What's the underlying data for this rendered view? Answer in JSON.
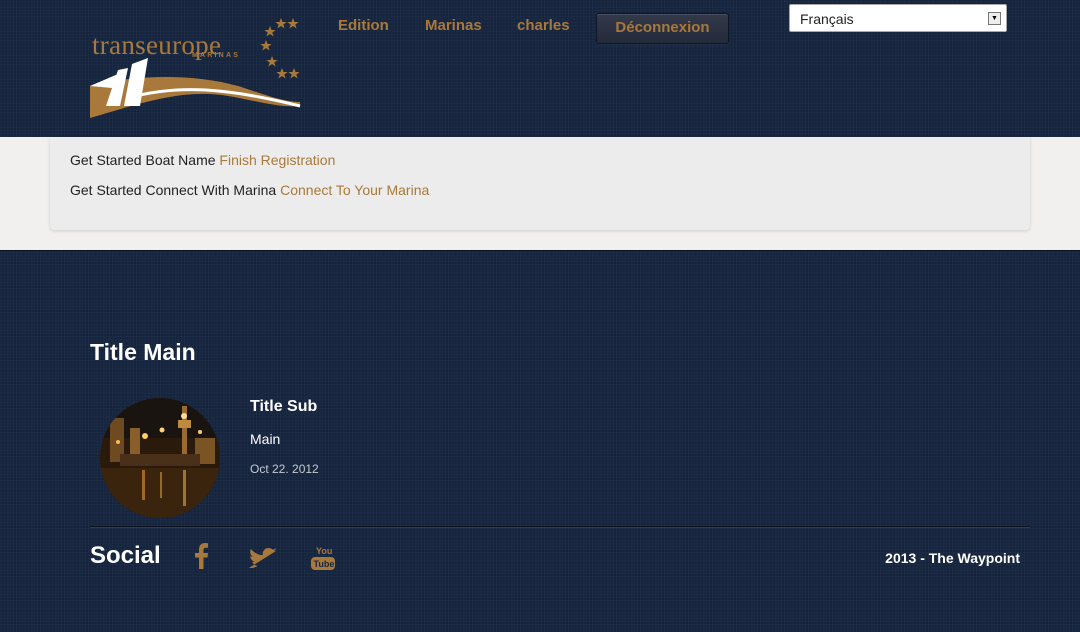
{
  "header": {
    "logo": {
      "name": "transeurope",
      "sub": "MARINAS"
    },
    "nav": {
      "edition": "Edition",
      "marinas": "Marinas",
      "user": "charles",
      "logout": "Déconnexion"
    },
    "language": {
      "selected": "Français"
    }
  },
  "content": {
    "rows": [
      {
        "text": "Get Started Boat Name",
        "link": "Finish Registration"
      },
      {
        "text": "Get Started Connect With Marina",
        "link": "Connect To Your Marina"
      }
    ]
  },
  "footer": {
    "title": "Title Main",
    "post": {
      "title": "Title Sub",
      "main": "Main",
      "date": "Oct 22. 2012"
    },
    "social": {
      "label": "Social",
      "icons": [
        "facebook-icon",
        "twitter-icon",
        "youtube-icon"
      ],
      "youtube_text": [
        "You",
        "Tube"
      ]
    },
    "copyright": "2013 - The Waypoint"
  },
  "colors": {
    "navy": "#172640",
    "accent": "#a9793b",
    "panel": "#ececec"
  }
}
